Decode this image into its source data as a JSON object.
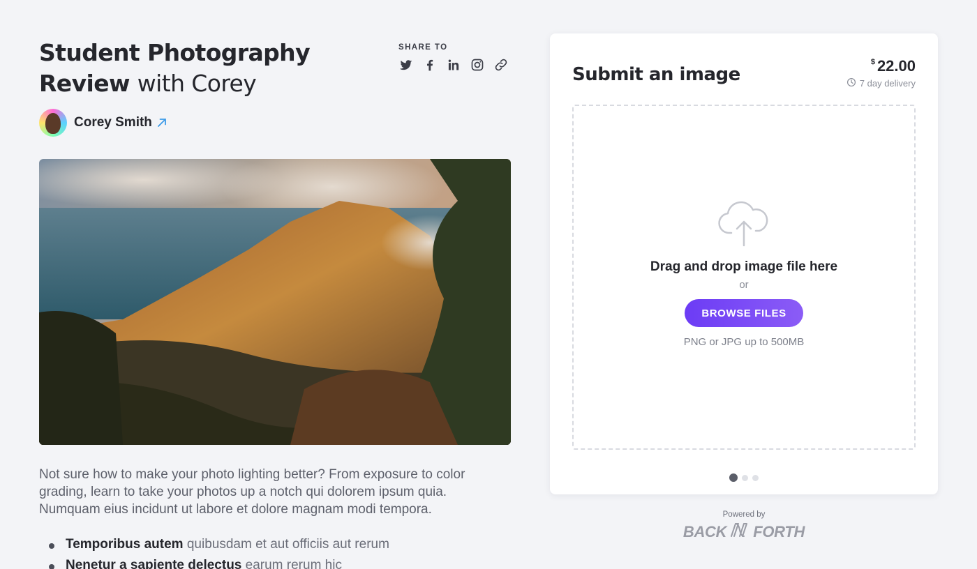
{
  "header": {
    "title_bold": "Student Photography Review",
    "title_regular": "with Corey"
  },
  "share": {
    "label": "SHARE TO",
    "icons": [
      "twitter-icon",
      "facebook-icon",
      "linkedin-icon",
      "instagram-icon",
      "link-icon"
    ]
  },
  "author": {
    "name": "Corey Smith"
  },
  "description": "Not sure how to make your photo lighting better? From exposure to color grading, learn to take your photos up a notch qui dolorem ipsum quia. Numquam eius incidunt ut labore et dolore magnam modi tempora.",
  "bullets": [
    {
      "bold": "Temporibus autem",
      "rest": "quibusdam et aut officiis aut rerum"
    },
    {
      "bold": "Nenetur a sapiente delectus",
      "rest": "earum rerum hic"
    }
  ],
  "card": {
    "title": "Submit an image",
    "currency": "$",
    "price": "22.00",
    "delivery": "7 day delivery",
    "drop_text": "Drag and drop image file here",
    "or_text": "or",
    "browse_label": "BROWSE FILES",
    "hint": "PNG or JPG up to 500MB",
    "carousel": {
      "count": 3,
      "active": 1
    }
  },
  "footer": {
    "powered_by": "Powered by",
    "brand_left": "BACK",
    "brand_right": "FORTH"
  },
  "colors": {
    "background": "#f3f4f7",
    "accent": "#7048f6",
    "link": "#3b9ae8",
    "text": "#25262c"
  }
}
